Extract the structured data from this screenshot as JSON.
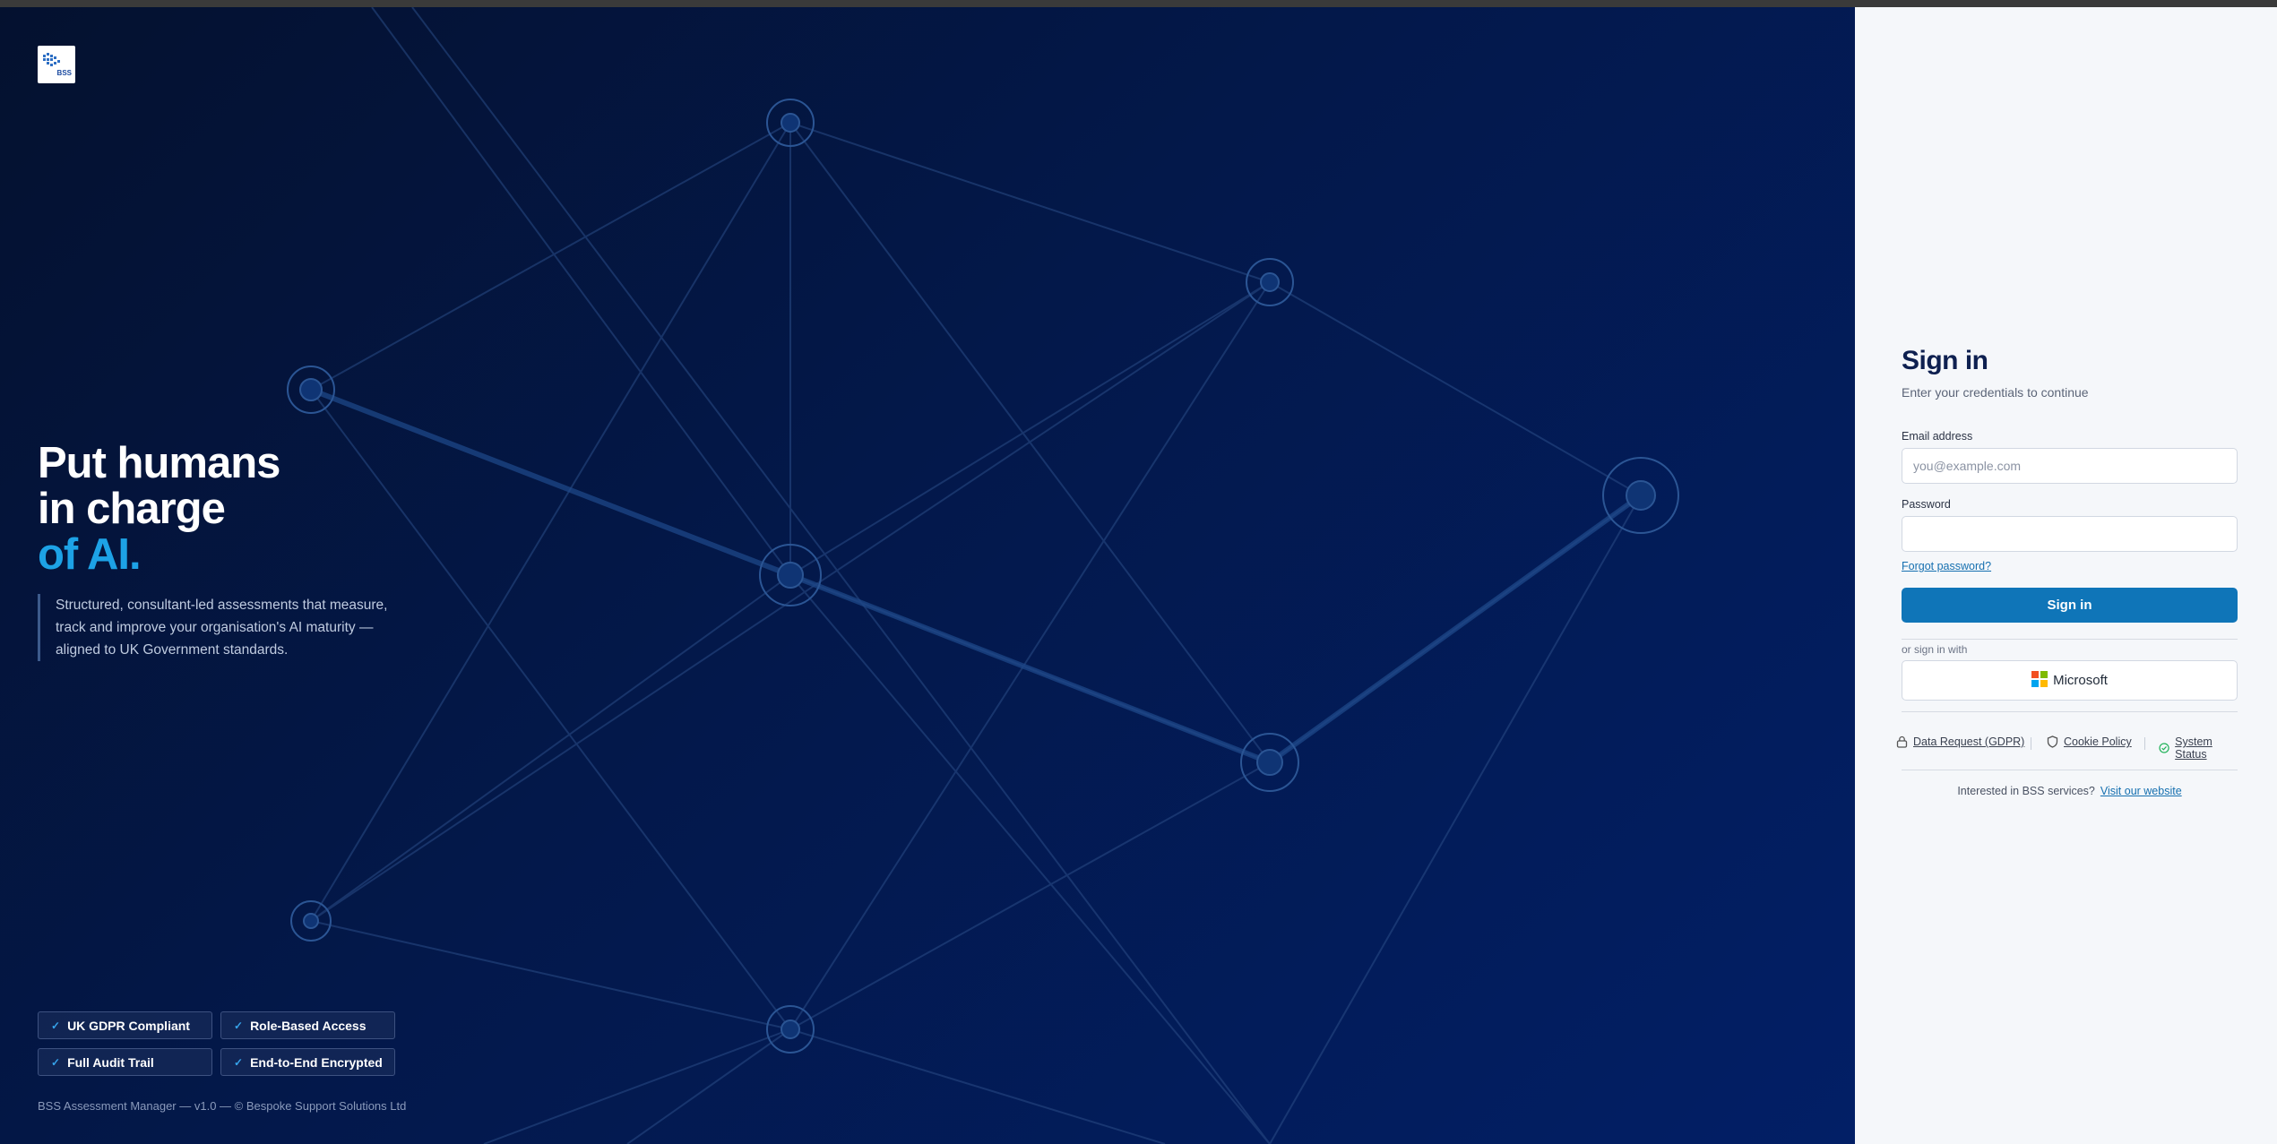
{
  "brand": {
    "logo_text": "BSS"
  },
  "hero": {
    "line1": "Put humans",
    "line2": "in charge",
    "line3": "of AI.",
    "tagline": "Structured, consultant-led assessments that measure, track and improve your organisation's AI maturity — aligned to UK Government standards."
  },
  "badges": [
    {
      "label": "UK GDPR Compliant"
    },
    {
      "label": "Role-Based Access"
    },
    {
      "label": "Full Audit Trail"
    },
    {
      "label": "End-to-End Encrypted"
    }
  ],
  "footer": {
    "text": "BSS Assessment Manager — v1.0 — © Bespoke Support Solutions Ltd"
  },
  "signin": {
    "title": "Sign in",
    "subtitle": "Enter your credentials to continue",
    "email_label": "Email address",
    "email_placeholder": "you@example.com",
    "email_value": "",
    "password_label": "Password",
    "password_value": "",
    "forgot_label": "Forgot password?",
    "submit_label": "Sign in",
    "or_text": "or sign in with",
    "microsoft_label": "Microsoft"
  },
  "links": {
    "gdpr": "Data Request (GDPR)",
    "cookie": "Cookie Policy",
    "status": "System Status"
  },
  "interest": {
    "text": "Interested in BSS services?",
    "link": "Visit our website"
  },
  "colors": {
    "accent": "#1da2e6",
    "primary_button": "#0f75b8",
    "title": "#0e2050",
    "status_ok": "#22b35a",
    "ms_red": "#f25022",
    "ms_green": "#7fba00",
    "ms_blue": "#00a4ef",
    "ms_yellow": "#ffb900"
  }
}
